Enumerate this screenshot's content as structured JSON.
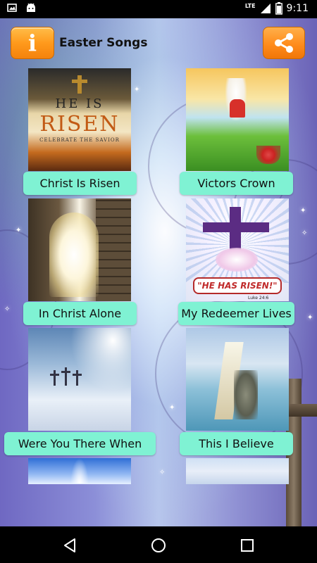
{
  "status_bar": {
    "time": "9:11",
    "network": "LTE",
    "icons": [
      "image-icon",
      "android-icon",
      "signal-icon",
      "battery-icon"
    ]
  },
  "header": {
    "info_label": "i",
    "title": "Easter Songs",
    "share_icon": "share-icon"
  },
  "thumbnail_text": {
    "he_is": "HE IS",
    "risen": "RISEN",
    "celebrate": "CELEBRATE THE SAVIOR",
    "he_has_risen": "\"HE HAS RISEN!\"",
    "luke": "Luke 24:6"
  },
  "songs": [
    {
      "label": "Christ Is Risen"
    },
    {
      "label": "Victors Crown"
    },
    {
      "label": "In Christ Alone"
    },
    {
      "label": "My Redeemer Lives"
    },
    {
      "label": "Were You There When"
    },
    {
      "label": "This I Believe"
    }
  ],
  "nav": {
    "back_icon": "back-icon",
    "home_icon": "home-icon",
    "recents_icon": "recents-icon"
  }
}
